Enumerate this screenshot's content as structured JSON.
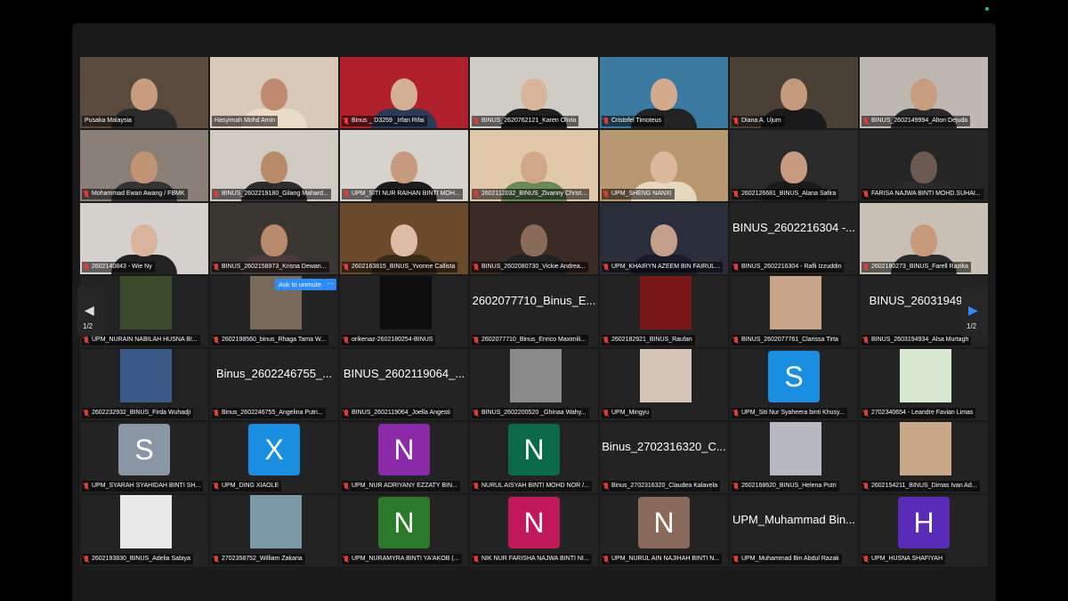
{
  "tiles": [
    {
      "label": "Pusaka Malaysia",
      "kind": "video",
      "bg": "#5a4a3e",
      "skin": "#c89c7c",
      "shirt": "#2b2b2b",
      "mic": false
    },
    {
      "label": "Hasyimah Mohd Amin",
      "kind": "video",
      "bg": "#d8c8b8",
      "skin": "#c08a70",
      "shirt": "#e8dcc8",
      "mic": false,
      "active": true
    },
    {
      "label": "Binus _ D3259 _Irfan Rifai",
      "kind": "video",
      "bg": "#b0202a",
      "skin": "#d4b096",
      "shirt": "#2a3a5a",
      "mic": true
    },
    {
      "label": "BINUS_2620762121_Karen Olivia",
      "kind": "video",
      "bg": "#d0ccc6",
      "skin": "#d8b49a",
      "shirt": "#1e1e1e",
      "mic": true
    },
    {
      "label": "Cristofel Timoteus",
      "kind": "video",
      "bg": "#3a7aa0",
      "skin": "#d2aa8c",
      "shirt": "#222",
      "mic": true
    },
    {
      "label": "Diana A. Ujum",
      "kind": "video",
      "bg": "#4a4036",
      "skin": "#c49a7c",
      "shirt": "#1a1a1a",
      "mic": true
    },
    {
      "label": "BINUS_2602149994_Alton Dejuda",
      "kind": "video",
      "bg": "#bdb8b2",
      "skin": "#c89e80",
      "shirt": "#2a2a2a",
      "mic": true
    },
    {
      "label": "Mohammad Ewan Awang / FBMK",
      "kind": "video",
      "bg": "#8a8078",
      "skin": "#c29474",
      "shirt": "#333",
      "mic": true
    },
    {
      "label": "BINUS_2602219180_Gilang Mahard...",
      "kind": "video",
      "bg": "#cfcac2",
      "skin": "#b88a68",
      "shirt": "#2c2c2c",
      "mic": true
    },
    {
      "label": "UPM_SITI NUR RAIHAN BINTI MOH...",
      "kind": "video",
      "bg": "#d6d2cc",
      "skin": "#c69a7e",
      "shirt": "#1c1c1c",
      "mic": true
    },
    {
      "label": "2602112032_BINUS_Zivanny Christ...",
      "kind": "video",
      "bg": "#e0c8a8",
      "skin": "#d0a888",
      "shirt": "#6a8a5a",
      "mic": true
    },
    {
      "label": "UPM_SHENG NANXI",
      "kind": "video",
      "bg": "#b89870",
      "skin": "#dcb89c",
      "shirt": "#e6d8c0",
      "mic": true
    },
    {
      "label": "2602126681_BINUS_Alana Safira",
      "kind": "video",
      "bg": "#2a2a2a",
      "skin": "#c89a80",
      "shirt": "#1a1a1a",
      "mic": true
    },
    {
      "label": "FARISA NAJWA BINTI MOHD.SUHAI...",
      "kind": "video",
      "bg": "#252525",
      "skin": "#6a5a50",
      "shirt": "#2a2a2a",
      "mic": true
    },
    {
      "label": "2602140843 - Wie Ny",
      "kind": "video",
      "bg": "#d4d0cc",
      "skin": "#d8b49c",
      "shirt": "#222",
      "mic": true
    },
    {
      "label": "BINUS_2602158973_Krisna Dewan...",
      "kind": "video",
      "bg": "#3a3632",
      "skin": "#b8896a",
      "shirt": "#4a3a3a",
      "mic": true
    },
    {
      "label": "2602163815_BINUS_Yvonne Callista",
      "kind": "video",
      "bg": "#6a4a2a",
      "skin": "#dcbca4",
      "shirt": "#3a2a1a",
      "mic": true
    },
    {
      "label": "BINUS_2602080730_Vickie Andrea...",
      "kind": "video",
      "bg": "#3a2c24",
      "skin": "#8a6a58",
      "shirt": "#222",
      "mic": true
    },
    {
      "label": "UPM_KHAIRYN AZEEM BIN FAIRUL...",
      "kind": "video",
      "bg": "#2a2e3a",
      "skin": "#c4a08a",
      "shirt": "#1a1a2a",
      "mic": true
    },
    {
      "label": "BINUS_2602216304 - Rafli Izzuddin",
      "kind": "name",
      "name": "BINUS_2602216304 -...",
      "mic": true
    },
    {
      "label": "2602180273_BINUS_Farell Razika",
      "kind": "video",
      "bg": "#c8c0b4",
      "skin": "#c89a7c",
      "shirt": "#2a2a2a",
      "mic": true
    },
    {
      "label": "UPM_NURAIN NABILAH HUSNA BI...",
      "kind": "thumb",
      "thumb": "#3a4a2a",
      "mic": true
    },
    {
      "label": "2602198560_binus_Rhaga Tama W...",
      "kind": "thumb",
      "thumb": "#7a6a5a",
      "mic": true
    },
    {
      "label": "orikenaz-2602180254-BINUS",
      "kind": "thumb",
      "thumb": "#0e0e0e",
      "mic": true
    },
    {
      "label": "2602077710_Binus_Enrico Maximili...",
      "kind": "name",
      "name": "2602077710_Binus_E...",
      "mic": true
    },
    {
      "label": "2602182921_BINUS_Raufan",
      "kind": "thumb",
      "thumb": "#7a1818",
      "mic": true
    },
    {
      "label": "BINUS_2602077761_Clarissa Tirta",
      "kind": "thumb",
      "thumb": "#c8a488",
      "mic": true
    },
    {
      "label": "BINUS_2603194934_Alsa Murtagh",
      "kind": "name",
      "name": "BINUS_260319493...",
      "mic": true
    },
    {
      "label": "2602232932_BINUS_Firda Wuhadji",
      "kind": "thumb",
      "thumb": "#3a5a8a",
      "mic": true
    },
    {
      "label": "Binus_2602246755_Angelina Putri...",
      "kind": "name",
      "name": "Binus_2602246755_...",
      "mic": true
    },
    {
      "label": "BINUS_2602119064_Joella Angesti",
      "kind": "name",
      "name": "BINUS_2602119064_...",
      "mic": true
    },
    {
      "label": "BINUS_2602200520 _Ghinaa Wahy...",
      "kind": "thumb",
      "thumb": "#8a8a8a",
      "mic": true
    },
    {
      "label": "UPM_Mingyu",
      "kind": "thumb",
      "thumb": "#d4c4b4",
      "mic": true
    },
    {
      "label": "UPM_Siti Nur Syaheera binti Khusy...",
      "kind": "avatar",
      "letter": "S",
      "color": "#1a8ee0",
      "mic": true
    },
    {
      "label": "2702340654 - Leandre Favian Limas",
      "kind": "thumb",
      "thumb": "#d8e8d0",
      "mic": true
    },
    {
      "label": "UPM_SYARAH SYAHIDAH BINTI SH...",
      "kind": "avatar",
      "letter": "S",
      "color": "#8a96a4",
      "mic": true
    },
    {
      "label": "UPM_DING XIAOLE",
      "kind": "avatar",
      "letter": "X",
      "color": "#1a8ee0",
      "mic": true
    },
    {
      "label": "UPM_NUR ADRIYANY EZZATY BIN...",
      "kind": "avatar",
      "letter": "N",
      "color": "#8a2aa8",
      "mic": true
    },
    {
      "label": "NURUL AISYAH BINTI MOHD NOR /...",
      "kind": "avatar",
      "letter": "N",
      "color": "#0a6a4a",
      "mic": true
    },
    {
      "label": "Binus_2702316320_Claudea Kalavela",
      "kind": "name",
      "name": "Binus_2702316320_C...",
      "mic": true
    },
    {
      "label": "2602168620_BINUS_Helena Putri",
      "kind": "thumb",
      "thumb": "#b8b8c0",
      "mic": true
    },
    {
      "label": "2602154211_BINUS_Dimas Ivan Ad...",
      "kind": "thumb",
      "thumb": "#c8a888",
      "mic": true
    },
    {
      "label": "2602193830_BINUS_Adelia Sabiya",
      "kind": "thumb",
      "thumb": "#e8e8e8",
      "mic": true
    },
    {
      "label": "2702358752_William Zakaria",
      "kind": "thumb",
      "thumb": "#7a9aa8",
      "mic": true
    },
    {
      "label": "UPM_NURAMYRA BINTI YA'AKOB (...",
      "kind": "avatar",
      "letter": "N",
      "color": "#2a7a2a",
      "mic": true
    },
    {
      "label": "NIK NUR FARISHA NAJWA BINTI NI...",
      "kind": "avatar",
      "letter": "N",
      "color": "#c0185a",
      "mic": true
    },
    {
      "label": "UPM_NURUL AIN NAJIHAH BINTI N...",
      "kind": "avatar",
      "letter": "N",
      "color": "#8a6a5a",
      "mic": true
    },
    {
      "label": "UPM_Muhammad Bin Abdul Razak",
      "kind": "name",
      "name": "UPM_Muhammad Bin...",
      "mic": true
    },
    {
      "label": "UPM_HUSNA SHAFIYAH",
      "kind": "avatar",
      "letter": "H",
      "color": "#5a2ab8",
      "mic": true
    }
  ],
  "overlay": {
    "ask_to_unmute": "Ask to unmute",
    "more": "···"
  },
  "pagination": {
    "left_page": "1/2",
    "right_page": "1/2",
    "left_arrow": "◀",
    "right_arrow": "▶"
  }
}
